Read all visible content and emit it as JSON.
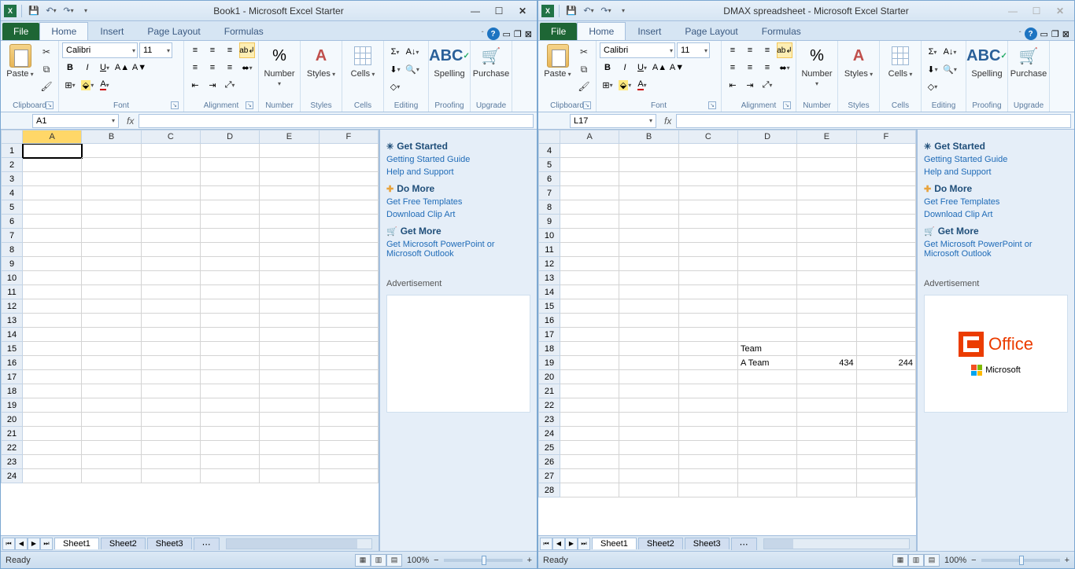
{
  "windows": [
    {
      "title": "Book1 - Microsoft Excel Starter",
      "namebox": "A1",
      "tabs": {
        "file": "File",
        "home": "Home",
        "insert": "Insert",
        "pagelayout": "Page Layout",
        "formulas": "Formulas"
      },
      "font": {
        "name": "Calibri",
        "size": "11"
      },
      "groups": {
        "clipboard": "Clipboard",
        "font": "Font",
        "alignment": "Alignment",
        "number": "Number",
        "styles": "Styles",
        "cells": "Cells",
        "editing": "Editing",
        "proofing": "Proofing",
        "upgrade": "Upgrade"
      },
      "bigbtns": {
        "paste": "Paste",
        "number": "Number",
        "styles": "Styles",
        "cells": "Cells",
        "spelling": "Spelling",
        "purchase": "Purchase"
      },
      "cols": [
        "A",
        "B",
        "C",
        "D",
        "E",
        "F"
      ],
      "col_sel": "A",
      "rows_start": 1,
      "rows_count": 24,
      "active_cell": "A1",
      "cells": {},
      "sheets": [
        "Sheet1",
        "Sheet2",
        "Sheet3"
      ],
      "status": "Ready",
      "zoom": "100%",
      "scroll_thumb_w": "90%",
      "sidepanel": {
        "get_started": "Get Started",
        "gs_guide": "Getting Started Guide",
        "help": "Help and Support",
        "do_more": "Do More",
        "templates": "Get Free Templates",
        "clipart": "Download Clip Art",
        "get_more": "Get More",
        "upsell": "Get Microsoft PowerPoint or Microsoft Outlook",
        "ad": "Advertisement",
        "show_office": false
      },
      "win_enabled": true
    },
    {
      "title": "DMAX spreadsheet - Microsoft Excel Starter",
      "namebox": "L17",
      "tabs": {
        "file": "File",
        "home": "Home",
        "insert": "Insert",
        "pagelayout": "Page Layout",
        "formulas": "Formulas"
      },
      "font": {
        "name": "Calibri",
        "size": "11"
      },
      "groups": {
        "clipboard": "Clipboard",
        "font": "Font",
        "alignment": "Alignment",
        "number": "Number",
        "styles": "Styles",
        "cells": "Cells",
        "editing": "Editing",
        "proofing": "Proofing",
        "upgrade": "Upgrade"
      },
      "bigbtns": {
        "paste": "Paste",
        "number": "Number",
        "styles": "Styles",
        "cells": "Cells",
        "spelling": "Spelling",
        "purchase": "Purchase"
      },
      "cols": [
        "A",
        "B",
        "C",
        "D",
        "E",
        "F"
      ],
      "col_sel": "",
      "rows_start": 4,
      "rows_count": 25,
      "active_cell": "",
      "cells": {
        "D18": "Team",
        "D19": "A Team",
        "E19": "434",
        "F19": "244"
      },
      "sheets": [
        "Sheet1",
        "Sheet2",
        "Sheet3"
      ],
      "status": "Ready",
      "zoom": "100%",
      "scroll_thumb_w": "20%",
      "sidepanel": {
        "get_started": "Get Started",
        "gs_guide": "Getting Started Guide",
        "help": "Help and Support",
        "do_more": "Do More",
        "templates": "Get Free Templates",
        "clipart": "Download Clip Art",
        "get_more": "Get More",
        "upsell": "Get Microsoft PowerPoint or Microsoft Outlook",
        "ad": "Advertisement",
        "show_office": true,
        "office": "Office",
        "microsoft": "Microsoft"
      },
      "win_enabled": false
    }
  ]
}
